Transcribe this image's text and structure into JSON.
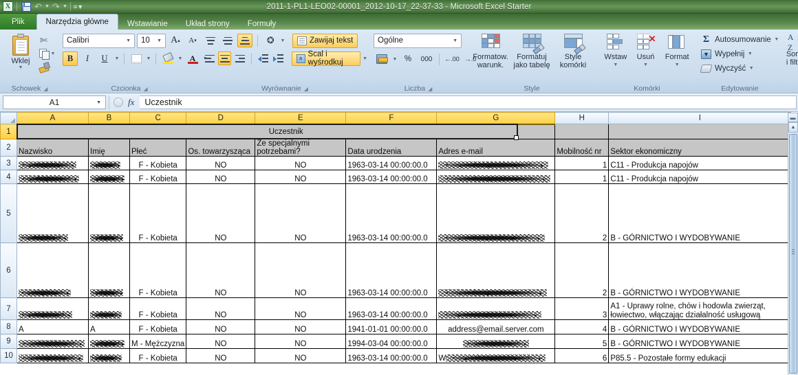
{
  "window": {
    "title": "2011-1-PL1-LEO02-00001_2012-10-17_22-37-33  -  Microsoft Excel Starter",
    "app_icon": "excel-icon"
  },
  "quick_access": [
    {
      "name": "save-icon",
      "label": "Zapisz"
    },
    {
      "name": "undo-icon",
      "label": "Cofnij"
    },
    {
      "name": "redo-icon",
      "label": "Wykonaj ponownie"
    },
    {
      "name": "customize-qat-icon",
      "label": "Dostosuj pasek"
    }
  ],
  "tabs": [
    {
      "label": "Plik",
      "active": false,
      "file": true
    },
    {
      "label": "Narzędzia główne",
      "active": true
    },
    {
      "label": "Wstawianie",
      "active": false
    },
    {
      "label": "Układ strony",
      "active": false
    },
    {
      "label": "Formuły",
      "active": false
    }
  ],
  "ribbon": {
    "clipboard": {
      "label": "Schowek",
      "paste": "Wklej",
      "cut": "Wytnij",
      "copy": "Kopiuj",
      "format_painter": "Malarz formatów"
    },
    "font": {
      "label": "Czcionka",
      "family": "Calibri",
      "size": "10",
      "grow": "A",
      "shrink": "A",
      "bold": "B",
      "italic": "I",
      "underline": "U",
      "borders": "Obramowania",
      "fill_color": "Kolor wypełnienia",
      "font_color": "A"
    },
    "alignment": {
      "label": "Wyrównanie",
      "wrap_text": "Zawijaj tekst",
      "merge_center": "Scal i wyśrodkuj",
      "orientation": "Orientacja",
      "decrease_indent": "Zmniejsz wcięcie",
      "increase_indent": "Zwiększ wcięcie"
    },
    "number": {
      "label": "Liczba",
      "format": "Ogólne",
      "accounting": "Format księgowy",
      "percent": "%",
      "comma": "000",
      "increase_decimal": "Zwiększ dziesiętne",
      "decrease_decimal": "Zmniejsz dziesiętne"
    },
    "styles": {
      "label": "Style",
      "conditional": "Formatow. warunk.",
      "as_table": "Formatuj jako tabelę",
      "cell_styles": "Style komórki"
    },
    "cells": {
      "label": "Komórki",
      "insert": "Wstaw",
      "delete": "Usuń",
      "format": "Format"
    },
    "editing": {
      "label": "Edytowanie",
      "autosum": "Autosumowanie",
      "fill": "Wypełnij",
      "clear": "Wyczyść",
      "sort_filter": "Sortuj i filtruj"
    }
  },
  "formula_bar": {
    "name_box": "A1",
    "formula": "Uczestnik",
    "fx": "fx"
  },
  "sheet": {
    "column_headers": [
      "A",
      "B",
      "C",
      "D",
      "E",
      "F",
      "G",
      "H",
      "I"
    ],
    "selected_columns": [
      "A",
      "B",
      "C",
      "D",
      "E",
      "F",
      "G"
    ],
    "row_numbers": [
      "1",
      "2",
      "3",
      "4",
      "5",
      "6",
      "7",
      "8",
      "9",
      "10"
    ],
    "selected_rows": [
      "1"
    ],
    "merged_title": "Uczestnik",
    "headers": [
      "Nazwisko",
      "Imię",
      "Płeć",
      "Os. towarzysząca",
      "Ze specjalnymi potrzebami?",
      "Data urodzenia",
      "Adres e-mail",
      "Mobilność nr",
      "Sektor ekonomiczny"
    ],
    "rows": [
      {
        "num": "3",
        "nazwisko": "",
        "nazwisko_redacted": true,
        "imie": "",
        "imie_redacted": true,
        "plec": "F - Kobieta",
        "os_tow": "NO",
        "spec": "NO",
        "data_ur": "1963-03-14 00:00:00.0",
        "email": "",
        "email_redacted": true,
        "mobilnosc": "1",
        "sektor": "C11 - Produkcja napojów"
      },
      {
        "num": "4",
        "nazwisko": "",
        "nazwisko_redacted": true,
        "imie": "",
        "imie_redacted": true,
        "plec": "F - Kobieta",
        "os_tow": "NO",
        "spec": "NO",
        "data_ur": "1963-03-14 00:00:00.0",
        "email": "",
        "email_redacted": true,
        "mobilnosc": "1",
        "sektor": "C11 - Produkcja napojów"
      },
      {
        "num": "5",
        "nazwisko": "",
        "nazwisko_redacted": true,
        "imie": "",
        "imie_redacted": true,
        "plec": "F - Kobieta",
        "os_tow": "NO",
        "spec": "NO",
        "data_ur": "1963-03-14 00:00:00.0",
        "email": "",
        "email_redacted": true,
        "mobilnosc": "2",
        "sektor": "B - GÓRNICTWO I WYDOBYWANIE"
      },
      {
        "num": "6",
        "nazwisko": "",
        "nazwisko_redacted": true,
        "imie": "",
        "imie_redacted": true,
        "plec": "F - Kobieta",
        "os_tow": "NO",
        "spec": "NO",
        "data_ur": "1963-03-14 00:00:00.0",
        "email": "",
        "email_redacted": true,
        "mobilnosc": "2",
        "sektor": "B - GÓRNICTWO I WYDOBYWANIE"
      },
      {
        "num": "7",
        "nazwisko": "",
        "nazwisko_redacted": true,
        "imie": "",
        "imie_redacted": true,
        "plec": "F - Kobieta",
        "os_tow": "NO",
        "spec": "NO",
        "data_ur": "1963-03-14 00:00:00.0",
        "email": "",
        "email_redacted": true,
        "mobilnosc": "3",
        "sektor": "A1 - Uprawy rolne, chów i hodowla zwierząt, łowiectwo, włączając działalność usługową"
      },
      {
        "num": "8",
        "nazwisko": "A",
        "nazwisko_redacted": false,
        "imie": "A",
        "imie_redacted": false,
        "plec": "F - Kobieta",
        "os_tow": "NO",
        "spec": "NO",
        "data_ur": "1941-01-01 00:00:00.0",
        "email": "address@email.server.com",
        "email_redacted": false,
        "mobilnosc": "4",
        "sektor": "B - GÓRNICTWO I WYDOBYWANIE"
      },
      {
        "num": "9",
        "nazwisko": "",
        "nazwisko_redacted": true,
        "imie": "",
        "imie_redacted": true,
        "plec": "M - Mężczyzna",
        "os_tow": "NO",
        "spec": "NO",
        "data_ur": "1994-03-04 00:00:00.0",
        "email": "",
        "email_redacted": true,
        "mobilnosc": "5",
        "sektor": "B - GÓRNICTWO I WYDOBYWANIE"
      },
      {
        "num": "10",
        "nazwisko": "",
        "nazwisko_redacted": true,
        "imie": "",
        "imie_redacted": true,
        "plec": "F - Kobieta",
        "os_tow": "NO",
        "spec": "NO",
        "data_ur": "1963-03-14 00:00:00.0",
        "email": "W",
        "email_redacted": true,
        "mobilnosc": "6",
        "sektor": "P85.5 - Pozostałe formy edukacji"
      }
    ]
  },
  "colors": {
    "titlebar": "#58874b",
    "ribbon": "#d2e1f0",
    "selected_header": "#ffd040",
    "merged_fill": "#c6c6c6",
    "file_tab": "#3f8a31"
  }
}
